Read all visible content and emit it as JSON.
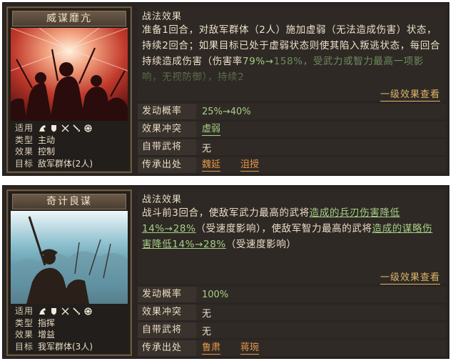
{
  "panels": [
    {
      "card": {
        "title": "威谋靡亢",
        "art": "red-battle-silhouettes",
        "info": [
          {
            "key": "适用",
            "value": ""
          },
          {
            "key": "类型",
            "value": "主动"
          },
          {
            "key": "效果",
            "value": "控制"
          },
          {
            "key": "目标",
            "value": "敌军群体(2人)"
          }
        ],
        "unit_icons": [
          "horse-icon",
          "shield-icon",
          "bow-icon",
          "spear-icon",
          "siege-icon"
        ]
      },
      "effect": {
        "title": "战法效果",
        "parts": [
          {
            "t": "准备1回合，对敌军群体（2人）施加虚弱（无法造成伤害）状态，持续2回合；如果目标已处于虚弱状态则使其陷入叛逃状态，每回合持续造成伤害（伤害率",
            "c": ""
          },
          {
            "t": "79%→",
            "c": "hl"
          },
          {
            "t": "158%，受武力或智力最高一项影响，无视防御），持续2",
            "c": "faded"
          }
        ],
        "more": "一级效果查看"
      },
      "rows": [
        {
          "key": "发动概率",
          "values": [
            "25%→40%"
          ],
          "style": "green"
        },
        {
          "key": "效果冲突",
          "values": [
            "虚弱"
          ],
          "style": "green-ul"
        },
        {
          "key": "自带武将",
          "values": [
            "无"
          ],
          "style": ""
        },
        {
          "key": "传承出处",
          "values": [
            "魏延",
            "沮授"
          ],
          "style": "orange-ul"
        }
      ]
    },
    {
      "card": {
        "title": "奇计良谋",
        "art": "blue-battle-silhouettes",
        "info": [
          {
            "key": "适用",
            "value": ""
          },
          {
            "key": "类型",
            "value": "指挥"
          },
          {
            "key": "效果",
            "value": "增益"
          },
          {
            "key": "目标",
            "value": "我军群体(3人)"
          }
        ],
        "unit_icons": [
          "horse-icon",
          "shield-icon",
          "bow-icon",
          "spear-icon",
          "siege-icon"
        ]
      },
      "effect": {
        "title": "战法效果",
        "parts": [
          {
            "t": "战斗前3回合，使敌军武力最高的武将",
            "c": ""
          },
          {
            "t": "造成的兵刃伤害降低14%→28%",
            "c": "hl ul"
          },
          {
            "t": "（受速度影响），使敌军智力最高的武将",
            "c": ""
          },
          {
            "t": "造成的谋略伤害降低14%→28%",
            "c": "hl ul"
          },
          {
            "t": "（受速度影响）",
            "c": ""
          }
        ],
        "more": "一级效果查看"
      },
      "rows": [
        {
          "key": "发动概率",
          "values": [
            "100%"
          ],
          "style": "green"
        },
        {
          "key": "效果冲突",
          "values": [
            "无"
          ],
          "style": ""
        },
        {
          "key": "自带武将",
          "values": [
            "无"
          ],
          "style": ""
        },
        {
          "key": "传承出处",
          "values": [
            "鲁肃",
            "蒋琬"
          ],
          "style": "orange-ul"
        }
      ]
    }
  ]
}
